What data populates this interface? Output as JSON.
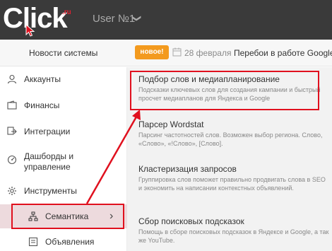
{
  "header": {
    "logo_text": "Click",
    "logo_suffix": ".ru",
    "user_name": "User №1",
    "user_chevron": "❯"
  },
  "newsbar": {
    "title": "Новости системы",
    "badge": "новое!",
    "date": "28 февраля",
    "link": "Перебои в работе Google"
  },
  "sidebar": {
    "items": [
      {
        "label": "Аккаунты",
        "icon": "user-icon"
      },
      {
        "label": "Финансы",
        "icon": "wallet-icon"
      },
      {
        "label": "Интеграции",
        "icon": "integration-icon"
      },
      {
        "label": "Дашборды и управление",
        "icon": "dashboard-icon"
      },
      {
        "label": "Инструменты",
        "icon": "gear-icon"
      }
    ],
    "sub_items": [
      {
        "label": "Семантика",
        "icon": "sitemap-icon",
        "chevron": "›",
        "active": true
      },
      {
        "label": "Объявления",
        "icon": "ad-icon",
        "active": false
      }
    ]
  },
  "menu": {
    "items": [
      {
        "title": "Подбор слов и медиапланирование",
        "desc": "Подсказки ключевых слов для создания кампании и быстрый просчет медиапланов для Яндекса и Google"
      },
      {
        "title": "Парсер Wordstat",
        "desc": "Парсинг частотностей слов. Возможен выбор региона. Слово, «Слово», «!Слово», [Слово]."
      },
      {
        "title": "Кластеризация запросов",
        "desc": "Группировка слов поможет правильно продвигать слова в SEO и экономить на написании контекстных объявлений."
      },
      {
        "title": "Сбор поисковых подсказок",
        "desc": "Помощь в сборе поисковых подсказок в Яндексе и Google, а так же YouTube."
      }
    ]
  },
  "colors": {
    "topbar": "#3a3a3a",
    "badge": "#f39a1e",
    "highlight": "#e0101e",
    "active_row": "#eddadd"
  }
}
